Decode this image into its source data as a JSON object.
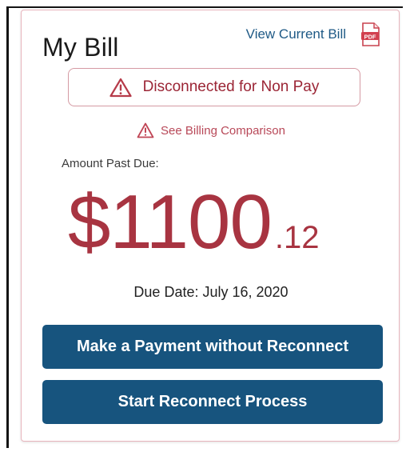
{
  "card": {
    "title": "My Bill",
    "view_bill_label": "View Current Bill",
    "pdf_icon_label": "PDF",
    "status": "Disconnected for Non Pay",
    "billing_comparison_label": "See Billing Comparison",
    "amount_label": "Amount Past Due:",
    "amount_dollars": "$1100",
    "amount_cents": ".12",
    "due_date_label": "Due Date:",
    "due_date_value": "July 16, 2020",
    "primary_button_label": "Make a Payment without Reconnect",
    "secondary_button_label": "Start Reconnect Process"
  },
  "colors": {
    "accent_red": "#a83441",
    "button_blue": "#17547e",
    "link_blue": "#1f5a86"
  },
  "icons": {
    "status_icon": "warning-triangle-icon",
    "comparison_icon": "warning-triangle-icon",
    "document_icon": "pdf-icon"
  }
}
